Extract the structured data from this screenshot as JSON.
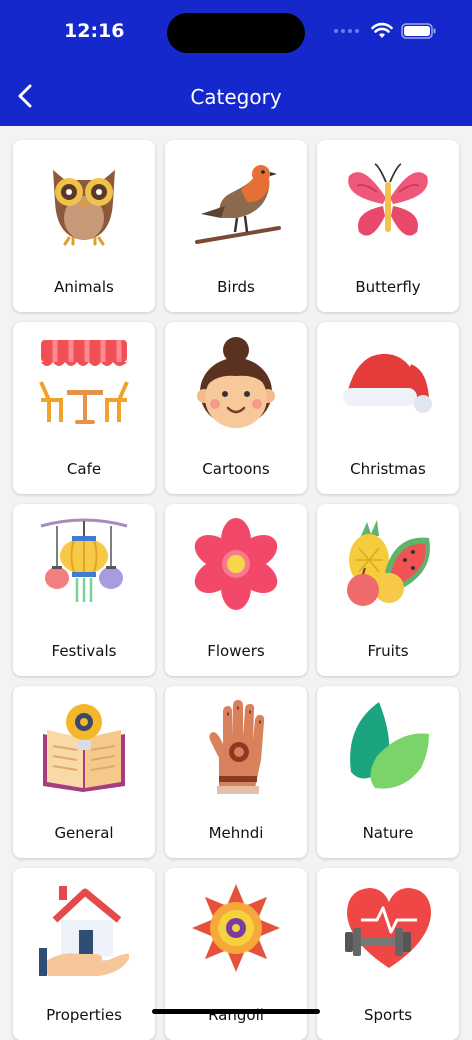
{
  "status_bar": {
    "time": "12:16"
  },
  "header": {
    "title": "Category"
  },
  "categories": [
    {
      "label": "Animals"
    },
    {
      "label": "Birds"
    },
    {
      "label": "Butterfly"
    },
    {
      "label": "Cafe"
    },
    {
      "label": "Cartoons"
    },
    {
      "label": "Christmas"
    },
    {
      "label": "Festivals"
    },
    {
      "label": "Flowers"
    },
    {
      "label": "Fruits"
    },
    {
      "label": "General"
    },
    {
      "label": "Mehndi"
    },
    {
      "label": "Nature"
    },
    {
      "label": "Properties"
    },
    {
      "label": "Rangoli"
    },
    {
      "label": "Sports"
    }
  ],
  "colors": {
    "header": "#1428cc",
    "card": "#ffffff",
    "background": "#f3f3f5"
  }
}
